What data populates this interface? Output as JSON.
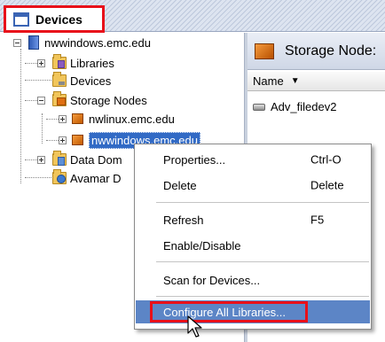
{
  "window": {
    "title": "Devices",
    "title_icon": "window-icon"
  },
  "tree": {
    "root": "nwwindows.emc.edu",
    "libraries": "Libraries",
    "devices": "Devices",
    "storage_nodes": "Storage Nodes",
    "sn_linux": "nwlinux.emc.edu",
    "sn_windows": "nwwindows.emc.edu",
    "data_domain": "Data Dom",
    "avamar": "Avamar D"
  },
  "right_pane": {
    "title": "Storage Node:",
    "column_name": "Name",
    "sort_icon": "sort-down-icon",
    "rows": [
      "Adv_filedev2"
    ]
  },
  "context_menu": {
    "items": [
      {
        "label": "Properties...",
        "shortcut": "Ctrl-O"
      },
      {
        "label": "Delete",
        "shortcut": "Delete"
      },
      {
        "label": "Refresh",
        "shortcut": "F5"
      },
      {
        "label": "Enable/Disable",
        "shortcut": ""
      },
      {
        "label": "Scan for Devices...",
        "shortcut": ""
      },
      {
        "label": "Configure All Libraries...",
        "shortcut": ""
      }
    ],
    "highlighted_item": "Configure All Libraries..."
  },
  "colors": {
    "highlight_box": "#e8101a",
    "selection": "#316ac5",
    "menu_hover": "#5c85c6"
  }
}
